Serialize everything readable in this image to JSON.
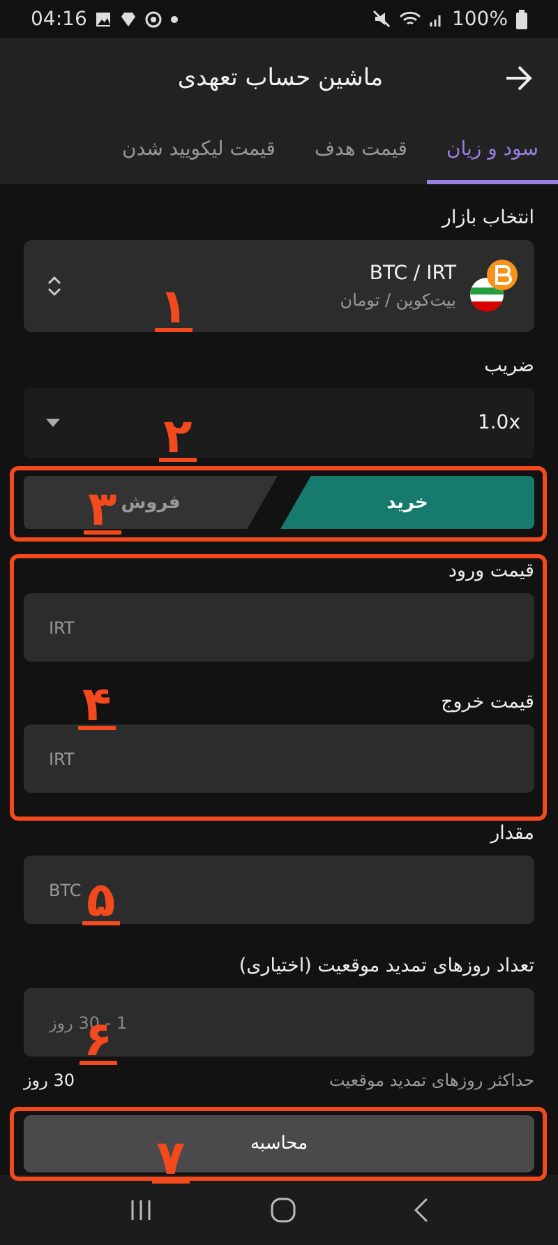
{
  "status_bar": {
    "time": "04:16",
    "battery": "100%"
  },
  "app_bar": {
    "title": "ماشین حساب تعهدی"
  },
  "tabs": [
    {
      "label": "سود و زیان",
      "selected": true
    },
    {
      "label": "قیمت هدف",
      "selected": false
    },
    {
      "label": "قیمت لیکویید شدن",
      "selected": false
    }
  ],
  "market": {
    "label": "انتخاب بازار",
    "pair": "BTC / IRT",
    "name": "بیت‌کوین / تومان"
  },
  "leverage": {
    "label": "ضریب",
    "value": "1.0x"
  },
  "sides": [
    {
      "label": "خرید",
      "selected": true
    },
    {
      "label": "فروش",
      "selected": false
    }
  ],
  "price_fields": [
    {
      "label": "قیمت ورود",
      "unit": "IRT"
    },
    {
      "label": "قیمت خروج",
      "unit": "IRT"
    }
  ],
  "amount": {
    "label": "مقدار",
    "unit": "BTC"
  },
  "days": {
    "label": "تعداد روزهای تمدید موقعیت (اختیاری)",
    "placeholder": "1 - 30 روز",
    "hint": "حداکثر روزهای تمدید موقعیت",
    "max": "30 روز"
  },
  "submit": {
    "label": "محاسبه"
  },
  "annotations": {
    "numbers": [
      "۱",
      "۲",
      "۳",
      "۴",
      "۵",
      "۶",
      "۷"
    ]
  }
}
